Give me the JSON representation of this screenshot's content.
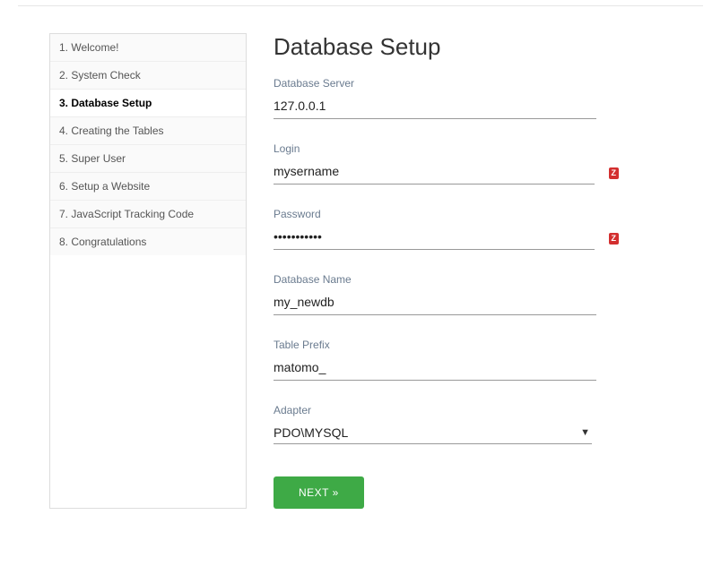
{
  "sidebar": {
    "items": [
      {
        "label": "1. Welcome!"
      },
      {
        "label": "2. System Check"
      },
      {
        "label": "3. Database Setup"
      },
      {
        "label": "4. Creating the Tables"
      },
      {
        "label": "5. Super User"
      },
      {
        "label": "6. Setup a Website"
      },
      {
        "label": "7. JavaScript Tracking Code"
      },
      {
        "label": "8. Congratulations"
      }
    ],
    "active_index": 2
  },
  "main": {
    "title": "Database Setup",
    "fields": {
      "server": {
        "label": "Database Server",
        "value": "127.0.0.1"
      },
      "login": {
        "label": "Login",
        "value": "mysername",
        "badge": "Z"
      },
      "password": {
        "label": "Password",
        "value": "mypassword1",
        "badge": "Z"
      },
      "dbname": {
        "label": "Database Name",
        "value": "my_newdb"
      },
      "prefix": {
        "label": "Table Prefix",
        "value": "matomo_"
      },
      "adapter": {
        "label": "Adapter",
        "value": "PDO\\MYSQL"
      }
    },
    "next_label": "NEXT »"
  }
}
